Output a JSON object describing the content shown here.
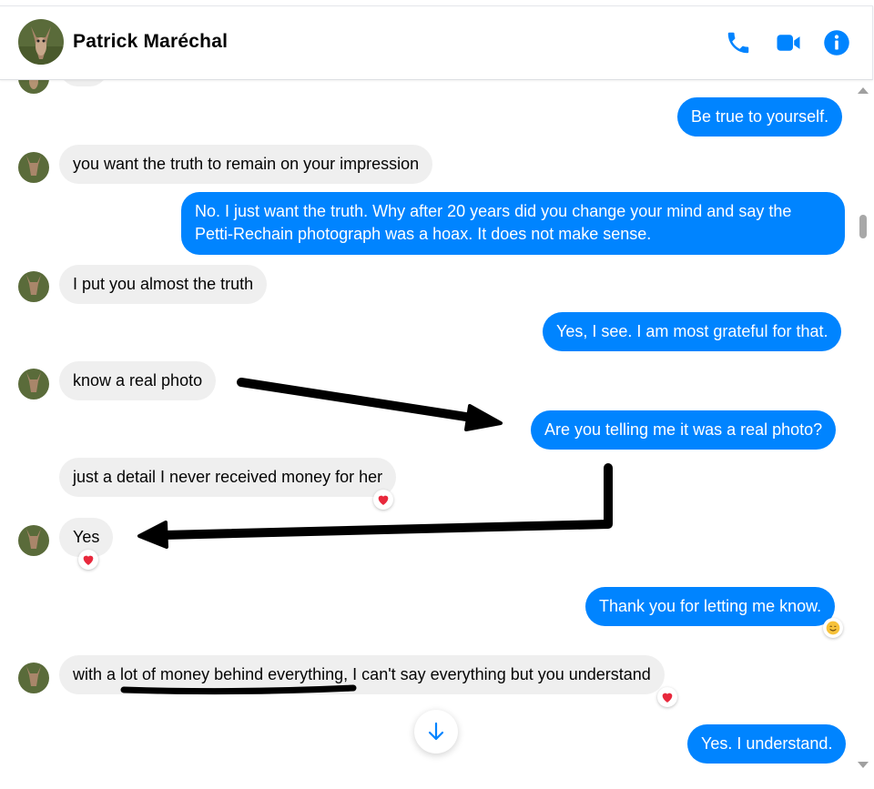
{
  "header": {
    "contact_name": "Patrick Maréchal",
    "icons": [
      "phone-icon",
      "video-camera-icon",
      "info-icon"
    ],
    "accent_color": "#0084ff"
  },
  "messages": [
    {
      "from": "me",
      "text": "Be true to yourself."
    },
    {
      "from": "them",
      "text": "you want the truth to remain on your impression"
    },
    {
      "from": "me",
      "text": "No. I just want the truth. Why after 20 years did you change your mind and say the Petti-Rechain photograph was a hoax. It does not make sense."
    },
    {
      "from": "them",
      "text": "I put you almost the truth"
    },
    {
      "from": "me",
      "text": "Yes, I see. I am most grateful for that."
    },
    {
      "from": "them",
      "text": "know a real photo"
    },
    {
      "from": "me",
      "text": "Are you telling me it was a real photo?"
    },
    {
      "from": "them",
      "text": "just a detail I never received money for her",
      "reaction": "heart"
    },
    {
      "from": "them",
      "text": "Yes",
      "reaction": "heart"
    },
    {
      "from": "me",
      "text": "Thank you for letting me know.",
      "reaction": "smiling-face"
    },
    {
      "from": "them",
      "text": "with a lot of money behind everything, I can't say everything but you understand",
      "reaction": "heart"
    },
    {
      "from": "me",
      "text": "Yes. I understand."
    }
  ],
  "colors": {
    "incoming_bubble": "#efefef",
    "outgoing_bubble": "#0084ff",
    "heart": "#e8283c"
  }
}
